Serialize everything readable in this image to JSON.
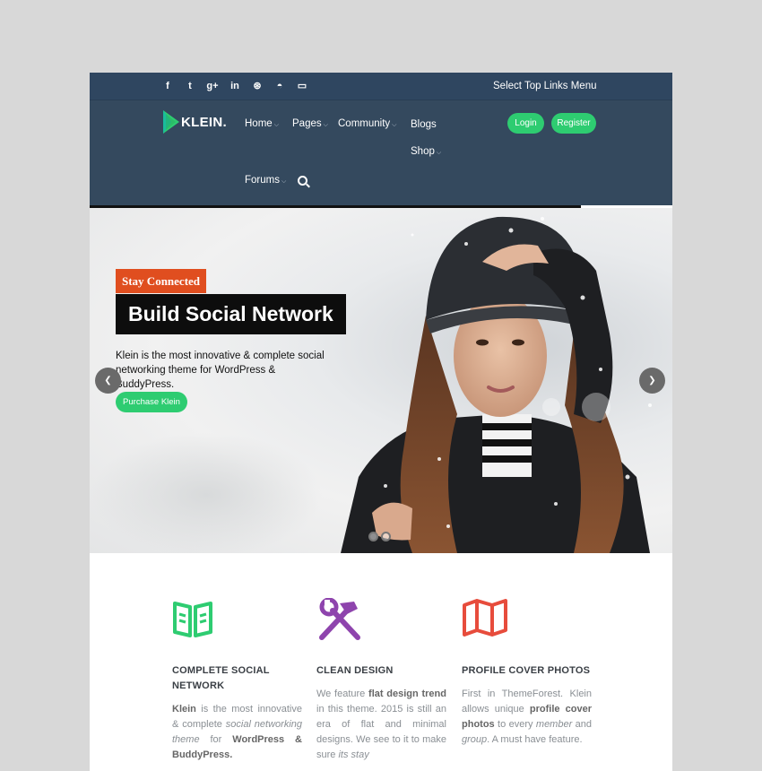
{
  "topbar": {
    "social_icons": [
      "facebook-icon",
      "twitter-icon",
      "google-plus-icon",
      "linkedin-icon",
      "dribbble-icon",
      "github-icon",
      "twitch-icon"
    ],
    "social_glyphs": [
      "f",
      "t",
      "g+",
      "in",
      "⊛",
      "◓",
      "▭"
    ],
    "top_links": "Select Top Links Menu"
  },
  "header": {
    "logo_text": "KLEIN.",
    "nav": {
      "home": "Home",
      "pages": "Pages",
      "community": "Community",
      "blogs": "Blogs",
      "shop": "Shop",
      "forums": "Forums"
    },
    "login": "Login",
    "register": "Register"
  },
  "hero": {
    "badge": "Stay Connected",
    "headline": "Build Social Network",
    "text": "Klein is the most innovative & complete social networking theme for WordPress & BuddyPress.",
    "cta": "Purchase Klein",
    "prev": "❮",
    "next": "❯",
    "slides": 2
  },
  "features": [
    {
      "title": "COMPLETE SOCIAL NETWORK",
      "icon": "open-book-icon",
      "color": "#2ecc71",
      "text_parts": [
        "Klein",
        " is the most innovative & complete ",
        "social networking theme",
        " for ",
        "WordPress & BuddyPress."
      ]
    },
    {
      "title": "CLEAN  DESIGN",
      "icon": "hammer-wrench-icon",
      "color": "#8e44ad",
      "text_parts": [
        "We feature ",
        "flat design trend",
        " in this theme. 2015 is still an era of flat and minimal designs. We see to it to make sure ",
        "its stay"
      ]
    },
    {
      "title": "PROFILE COVER PHOTOS",
      "icon": "map-icon",
      "color": "#e74c3c",
      "text_parts": [
        "First in ThemeForest. Klein allows unique ",
        "profile cover photos",
        " to every ",
        "member",
        " and ",
        "group",
        ". A must have feature."
      ]
    }
  ],
  "colors": {
    "navbar": "#34495e",
    "topbar": "#2f4660",
    "accent_green": "#2ecc71",
    "badge_orange": "#e04e1f"
  }
}
